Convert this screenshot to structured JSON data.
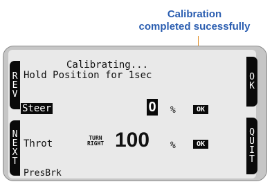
{
  "callout": {
    "line1": "Calibration",
    "line2": "completed sucessfully",
    "color": "#2a5db0",
    "leader_color": "#e08a1e"
  },
  "softkeys": {
    "left_top": [
      "R",
      "E",
      "V"
    ],
    "left_bottom": [
      "N",
      "E",
      "X",
      "T"
    ],
    "right_top": [
      "O",
      "K"
    ],
    "right_bottom": [
      "Q",
      "U",
      "I",
      "T"
    ]
  },
  "screen": {
    "title": "Calibrating...",
    "subtitle": "Hold Position for 1sec",
    "steer": {
      "label": "Steer",
      "value": "0",
      "unit": "%",
      "status": "OK"
    },
    "throt": {
      "label": "Throt",
      "mode_line1": "TURN",
      "mode_line2": "RIGHT",
      "value": "100",
      "unit": "%",
      "status": "OK"
    },
    "presbrk": {
      "label": "PresBrk"
    }
  }
}
